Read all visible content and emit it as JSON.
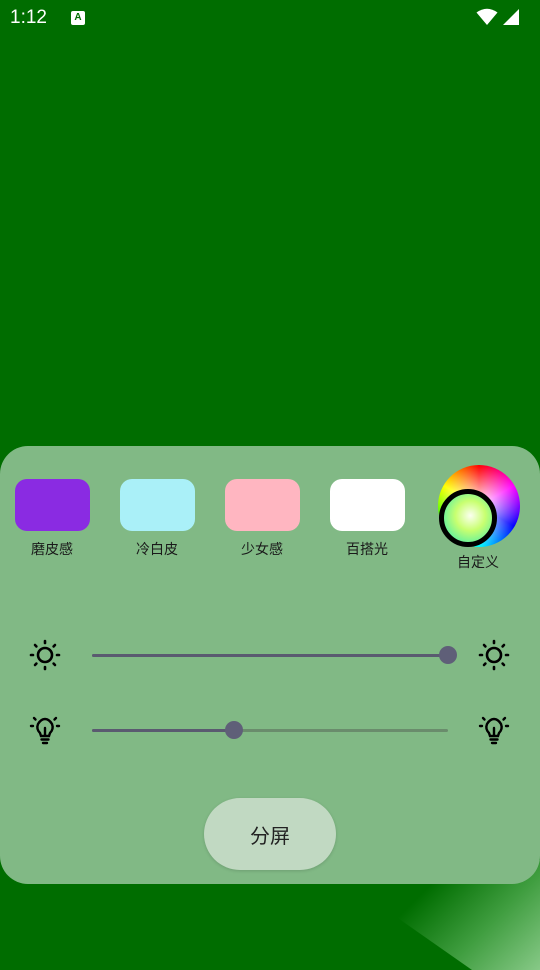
{
  "status_bar": {
    "time": "1:12",
    "notification_icon": "a11y-icon",
    "notification_glyph": "A",
    "wifi_icon": "wifi-icon",
    "signal_icon": "signal-icon"
  },
  "background_color": "#006d00",
  "panel": {
    "background_color": "#81b985",
    "presets": [
      {
        "label": "磨皮感",
        "color": "#8a2be2"
      },
      {
        "label": "冷白皮",
        "color": "#aaf0f8"
      },
      {
        "label": "少女感",
        "color": "#ffb6c1"
      },
      {
        "label": "百搭光",
        "color": "#ffffff"
      }
    ],
    "custom": {
      "label": "自定义",
      "icon": "color-wheel-icon"
    },
    "sliders": [
      {
        "name": "brightness",
        "icon_left": "sun-icon",
        "icon_right": "sun-icon",
        "value_percent": 100
      },
      {
        "name": "light",
        "icon_left": "lightbulb-icon",
        "icon_right": "lightbulb-icon",
        "value_percent": 40
      }
    ],
    "split_button_label": "分屏"
  }
}
